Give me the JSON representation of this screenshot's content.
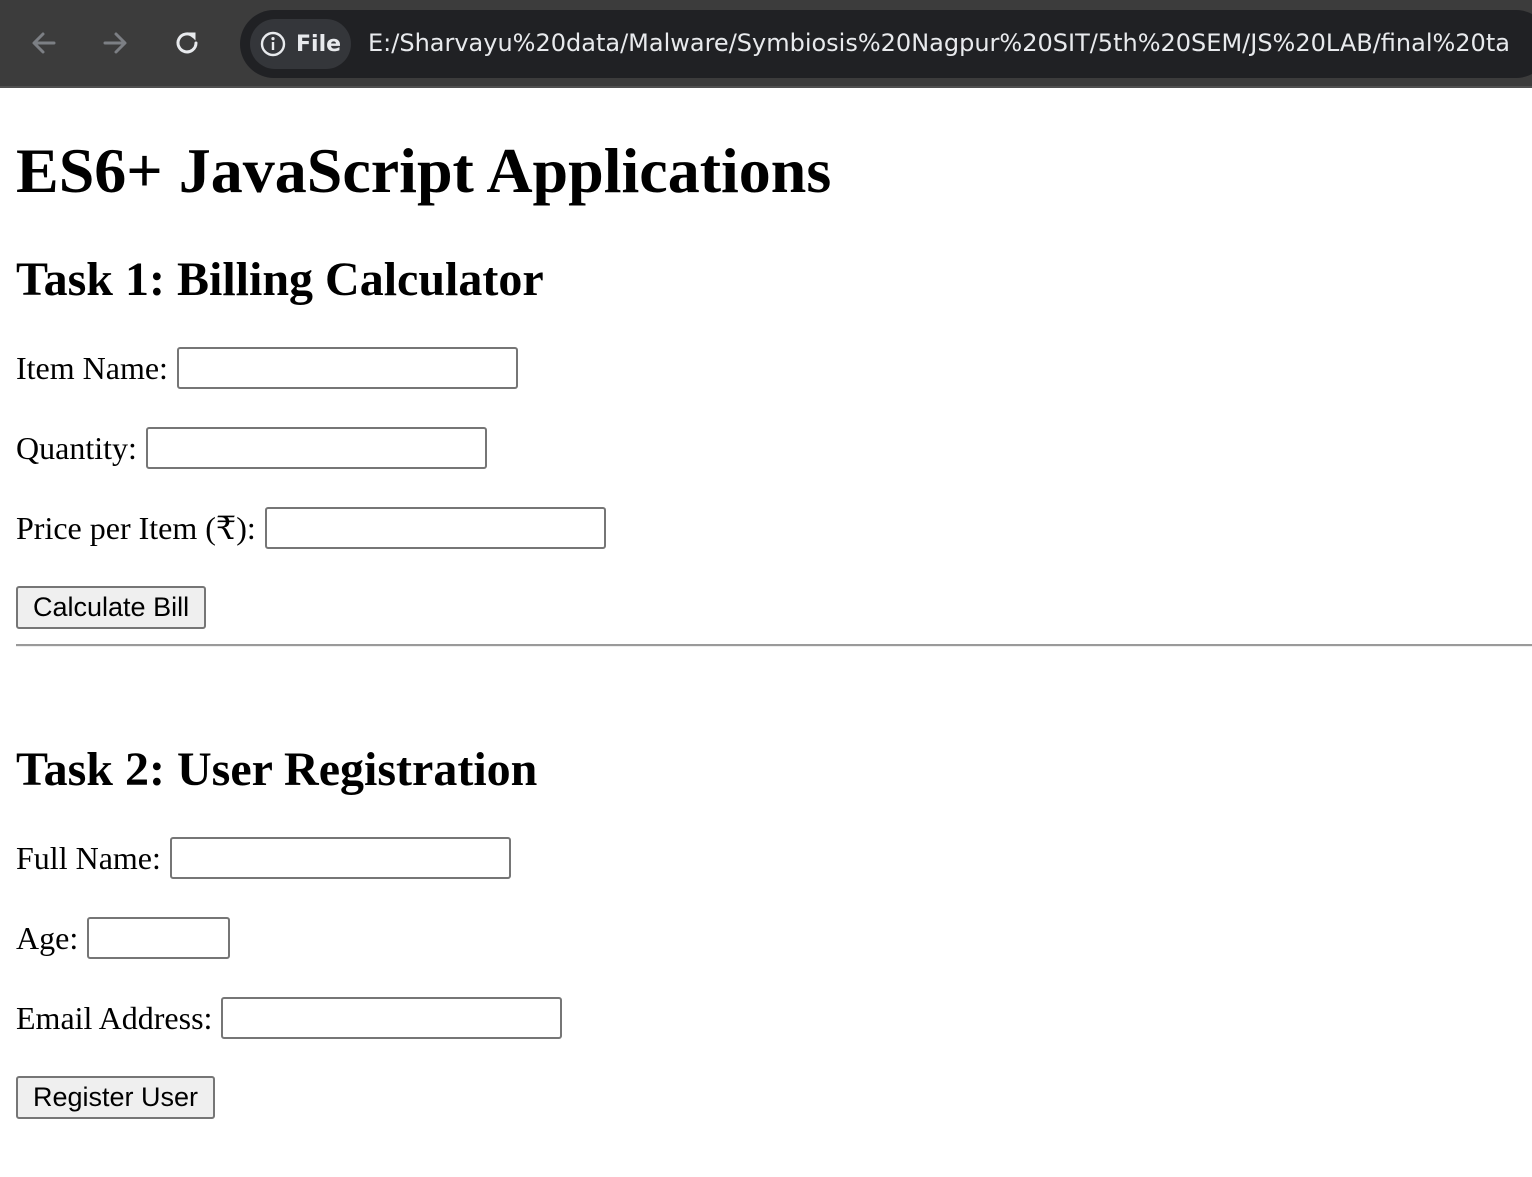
{
  "browser": {
    "scheme_label": "File",
    "url": "E:/Sharvayu%20data/Malware/Symbiosis%20Nagpur%20SIT/5th%20SEM/JS%20LAB/final%20ta"
  },
  "page": {
    "title": "ES6+ JavaScript Applications"
  },
  "task1": {
    "title": "Task 1: Billing Calculator",
    "item_name_label": "Item Name:",
    "item_name_value": "",
    "quantity_label": "Quantity:",
    "quantity_value": "",
    "price_label": "Price per Item (₹):",
    "price_value": "",
    "button_label": "Calculate Bill"
  },
  "task2": {
    "title": "Task 2: User Registration",
    "full_name_label": "Full Name:",
    "full_name_value": "",
    "age_label": "Age:",
    "age_value": "",
    "email_label": "Email Address:",
    "email_value": "",
    "button_label": "Register User"
  },
  "icons": {
    "back": "arrow-left-icon",
    "forward": "arrow-right-icon",
    "reload": "reload-icon",
    "info": "info-icon"
  }
}
